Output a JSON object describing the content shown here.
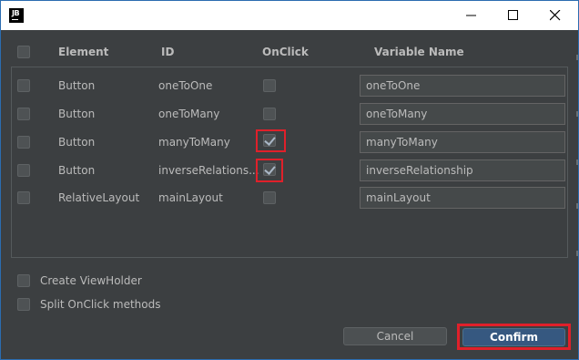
{
  "titlebar": {
    "app_icon_text": "JB"
  },
  "table": {
    "headers": {
      "element": "Element",
      "id": "ID",
      "onclick": "OnClick",
      "variable_name": "Variable Name"
    },
    "rows": [
      {
        "element": "Button",
        "id": "oneToOne",
        "onclick": false,
        "variable_name": "oneToOne"
      },
      {
        "element": "Button",
        "id": "oneToMany",
        "onclick": false,
        "variable_name": "oneToMany"
      },
      {
        "element": "Button",
        "id": "manyToMany",
        "onclick": true,
        "variable_name": "manyToMany"
      },
      {
        "element": "Button",
        "id": "inverseRelations...",
        "onclick": true,
        "variable_name": "inverseRelationship"
      },
      {
        "element": "RelativeLayout",
        "id": "mainLayout",
        "onclick": false,
        "variable_name": "mainLayout"
      }
    ]
  },
  "options": {
    "create_viewholder": "Create ViewHolder",
    "split_onclick": "Split OnClick methods"
  },
  "buttons": {
    "cancel": "Cancel",
    "confirm": "Confirm"
  },
  "colors": {
    "background": "#3c3f41",
    "highlight": "#e0202a",
    "confirm": "#365880"
  }
}
